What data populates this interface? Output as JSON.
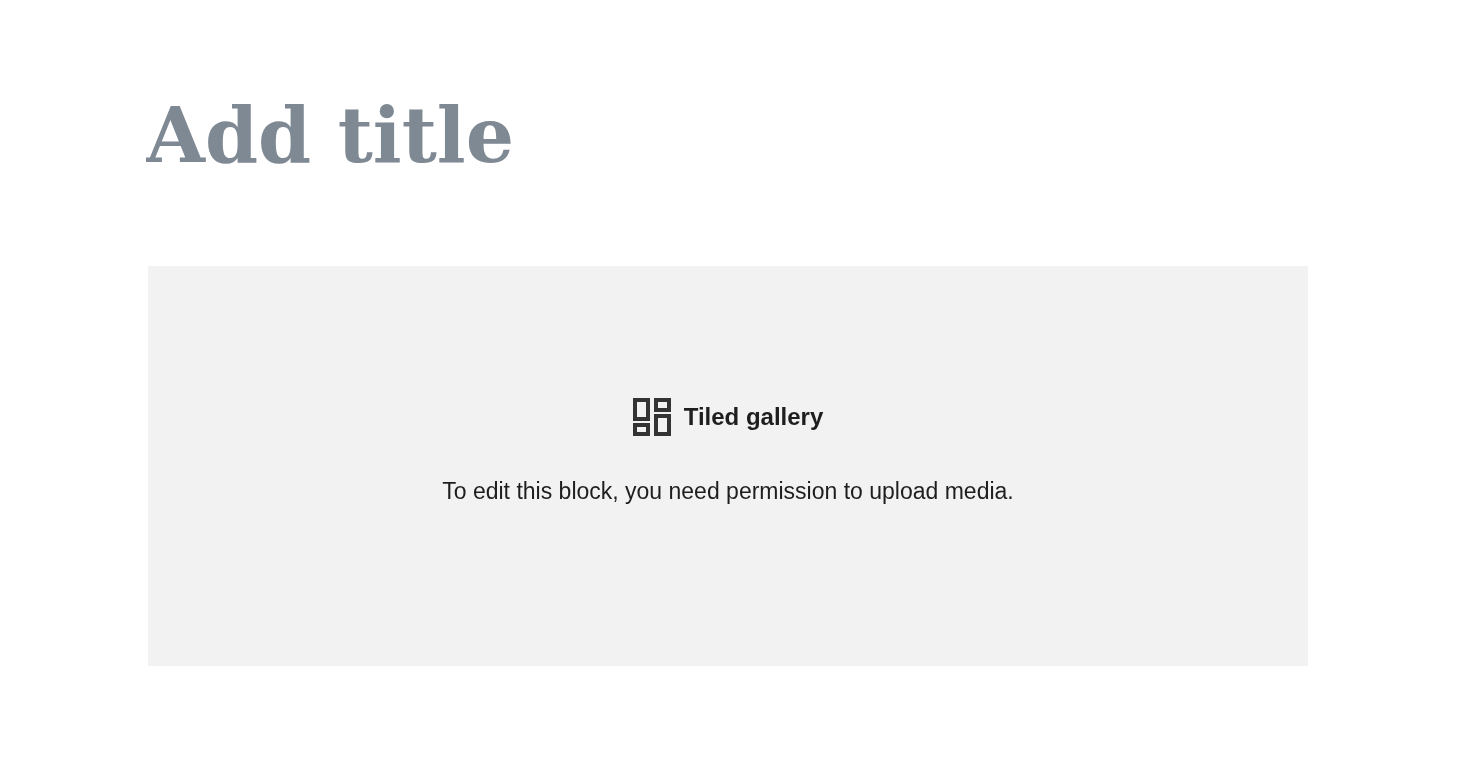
{
  "title": {
    "placeholder": "Add title"
  },
  "block": {
    "label": "Tiled gallery",
    "message": "To edit this block, you need permission to upload media."
  }
}
